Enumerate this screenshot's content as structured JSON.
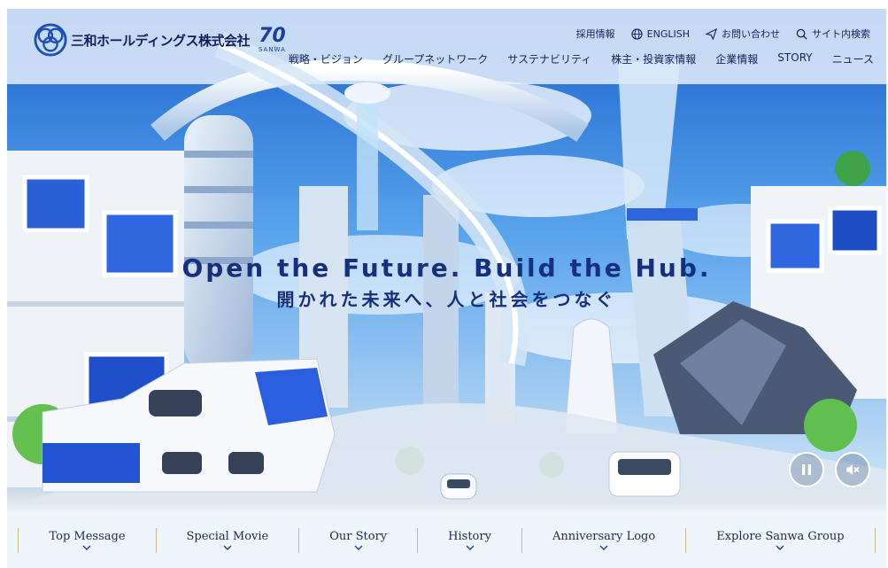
{
  "header": {
    "company_name": "三和ホールディングス株式会社",
    "anniversary_number": "70",
    "anniversary_word": "SANWA"
  },
  "utility_nav": [
    {
      "label": "採用情報",
      "icon": ""
    },
    {
      "label": "ENGLISH",
      "icon": "globe-icon"
    },
    {
      "label": "お問い合わせ",
      "icon": "paper-plane-icon"
    },
    {
      "label": "サイト内検索",
      "icon": "search-icon"
    }
  ],
  "global_nav": [
    "戦略・ビジョン",
    "グループネットワーク",
    "サステナビリティ",
    "株主・投資家情報",
    "企業情報",
    "STORY",
    "ニュース"
  ],
  "hero": {
    "headline_en": "Open the Future. Build the Hub.",
    "headline_ja": "開かれた未来へ、人と社会をつなぐ"
  },
  "media_controls": {
    "pause_icon": "pause-icon",
    "mute_icon": "mute-icon"
  },
  "bottom_nav": [
    "Top Message",
    "Special Movie",
    "Our Story",
    "History",
    "Anniversary Logo",
    "Explore Sanwa Group"
  ],
  "colors": {
    "brand_navy": "#12225e",
    "headline_blue": "#15307e",
    "accent_blue": "#1c3f9e",
    "separator_gold": "#c9b68a"
  }
}
